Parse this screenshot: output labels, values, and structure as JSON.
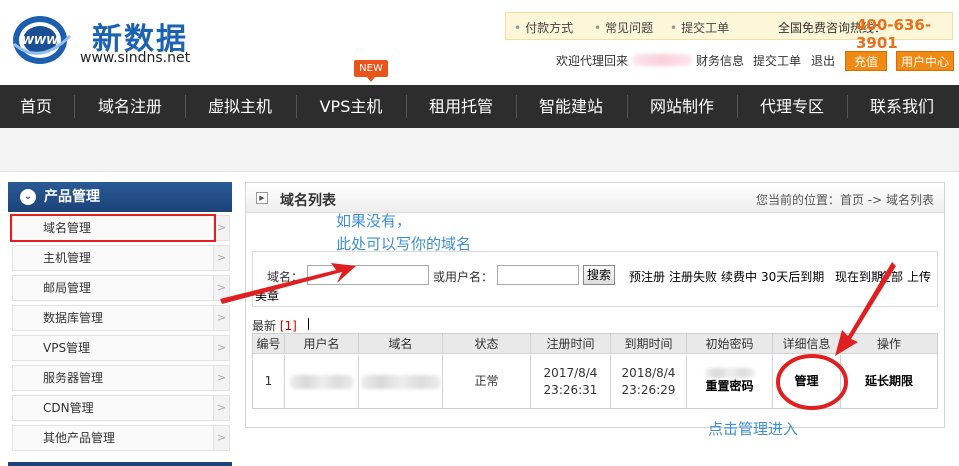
{
  "header": {
    "logo_badge": "WWW",
    "logo_cn": "新数据",
    "logo_url": "www.sindns.net",
    "help_links": [
      "付款方式",
      "常见问题",
      "提交工单"
    ],
    "hotline_label": "全国免费咨询热线：",
    "hotline_number": "400-636-3901",
    "welcome": "欢迎代理回来",
    "user_links": [
      "财务信息",
      "提交工单",
      "退出"
    ],
    "recharge_button": "充值",
    "user_center_button": "用户中心"
  },
  "nav": {
    "items": [
      "首页",
      "域名注册",
      "虚拟主机",
      "VPS主机",
      "租用托管",
      "智能建站",
      "网站制作",
      "代理专区",
      "联系我们"
    ],
    "new_badge": "NEW"
  },
  "sidebar": {
    "title": "产品管理",
    "items": [
      "域名管理",
      "主机管理",
      "邮局管理",
      "数据库管理",
      "VPS管理",
      "服务器管理",
      "CDN管理",
      "其他产品管理"
    ]
  },
  "panel": {
    "title": "域名列表",
    "breadcrumb": "您当前的位置：首页 -> 域名列表",
    "search": {
      "domain_label": "域名：",
      "domain_value": "",
      "user_label": "或用户名：",
      "user_value": "",
      "search_button": "搜索",
      "filters": [
        "预注册",
        "注册失败",
        "续费中",
        "30天后到期",
        "现在到期",
        "全部",
        "上传"
      ],
      "filter_overflow": "美章"
    },
    "latest_label": "最新",
    "latest_count": "[1]",
    "table": {
      "headers": [
        "编号",
        "用户名",
        "域名",
        "状态",
        "注册时间",
        "到期时间",
        "初始密码",
        "详细信息",
        "操作"
      ],
      "rows": [
        {
          "id": "1",
          "status": "正常",
          "reg_date": "2017/8/4",
          "reg_time": "23:26:31",
          "exp_date": "2018/8/4",
          "exp_time": "23:26:29",
          "reset_password": "重置密码",
          "manage": "管理",
          "extend": "延长期限"
        }
      ]
    }
  },
  "annotations": {
    "hint_line1": "如果没有，",
    "hint_line2": "此处可以写你的域名",
    "hint_manage": "点击管理进入",
    "color": "#e02020"
  }
}
